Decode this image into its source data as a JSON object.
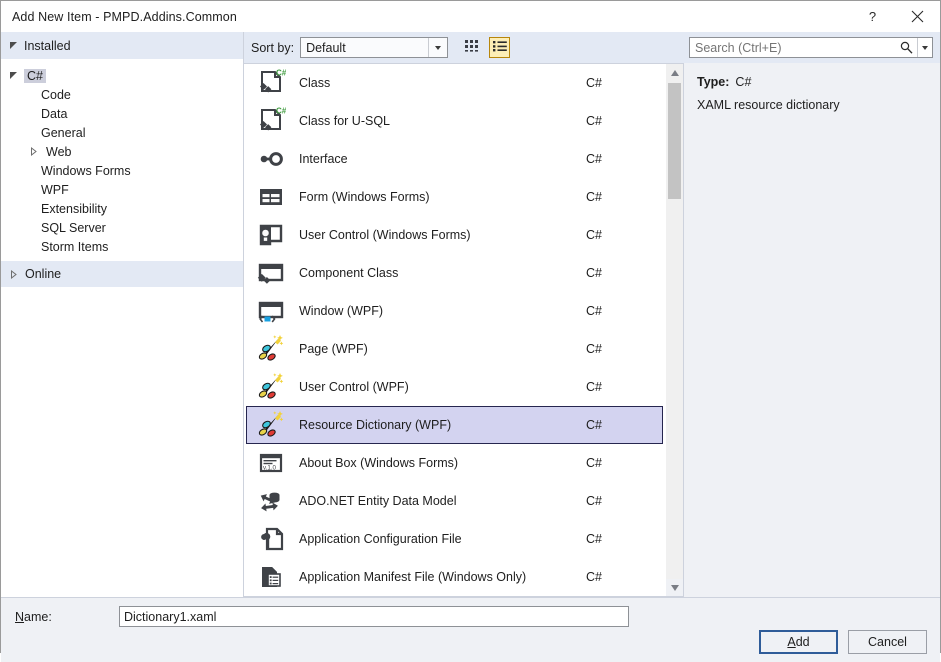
{
  "window": {
    "title": "Add New Item - PMPD.Addins.Common",
    "help_label": "?",
    "close_label": "✕"
  },
  "sidebar": {
    "installed_label": "Installed",
    "online_label": "Online",
    "items": [
      {
        "label": "C#",
        "level": 0,
        "expander": "down",
        "selected": true
      },
      {
        "label": "Code",
        "level": 1,
        "expander": "none",
        "selected": false
      },
      {
        "label": "Data",
        "level": 1,
        "expander": "none",
        "selected": false
      },
      {
        "label": "General",
        "level": 1,
        "expander": "none",
        "selected": false
      },
      {
        "label": "Web",
        "level": 1,
        "expander": "right",
        "selected": false
      },
      {
        "label": "Windows Forms",
        "level": 1,
        "expander": "none",
        "selected": false
      },
      {
        "label": "WPF",
        "level": 1,
        "expander": "none",
        "selected": false
      },
      {
        "label": "Extensibility",
        "level": 1,
        "expander": "none",
        "selected": false
      },
      {
        "label": "SQL Server",
        "level": 1,
        "expander": "none",
        "selected": false
      },
      {
        "label": "Storm Items",
        "level": 1,
        "expander": "none",
        "selected": false
      }
    ]
  },
  "toolbar": {
    "sort_by_label": "Sort by:",
    "sort_by_value": "Default",
    "tile_view_name": "tile-view",
    "list_view_name": "list-view",
    "active_view": "list"
  },
  "search": {
    "placeholder": "Search (Ctrl+E)",
    "value": ""
  },
  "list": {
    "items": [
      {
        "name": "Class",
        "lang": "C#",
        "icon": "class-icon",
        "selected": false
      },
      {
        "name": "Class for U-SQL",
        "lang": "C#",
        "icon": "class-icon",
        "selected": false
      },
      {
        "name": "Interface",
        "lang": "C#",
        "icon": "interface-icon",
        "selected": false
      },
      {
        "name": "Form (Windows Forms)",
        "lang": "C#",
        "icon": "form-icon",
        "selected": false
      },
      {
        "name": "User Control (Windows Forms)",
        "lang": "C#",
        "icon": "user-control-icon",
        "selected": false
      },
      {
        "name": "Component Class",
        "lang": "C#",
        "icon": "component-icon",
        "selected": false
      },
      {
        "name": "Window (WPF)",
        "lang": "C#",
        "icon": "window-icon",
        "selected": false
      },
      {
        "name": "Page (WPF)",
        "lang": "C#",
        "icon": "wand-icon",
        "selected": false
      },
      {
        "name": "User Control (WPF)",
        "lang": "C#",
        "icon": "wand-icon",
        "selected": false
      },
      {
        "name": "Resource Dictionary (WPF)",
        "lang": "C#",
        "icon": "wand-icon",
        "selected": true
      },
      {
        "name": "About Box (Windows Forms)",
        "lang": "C#",
        "icon": "about-box-icon",
        "selected": false
      },
      {
        "name": "ADO.NET Entity Data Model",
        "lang": "C#",
        "icon": "entity-model-icon",
        "selected": false
      },
      {
        "name": "Application Configuration File",
        "lang": "C#",
        "icon": "config-file-icon",
        "selected": false
      },
      {
        "name": "Application Manifest File (Windows Only)",
        "lang": "C#",
        "icon": "manifest-file-icon",
        "selected": false
      }
    ]
  },
  "details": {
    "type_label": "Type:",
    "type_value": "C#",
    "description": "XAML resource dictionary"
  },
  "footer": {
    "name_label": "Name:",
    "name_label_accel": "N",
    "name_label_rest": "ame:",
    "name_value": "Dictionary1.xaml",
    "add_label_accel": "A",
    "add_label_rest": "dd",
    "add_label": "Add",
    "cancel_label": "Cancel"
  },
  "colors": {
    "dialog_bg": "#eff1f5",
    "header_bg": "#e3e9f4",
    "selection_bg": "#d3d3f0",
    "selection_border": "#26264f",
    "active_toggle_bg": "#fdeeb6",
    "active_toggle_border": "#b8860b"
  }
}
